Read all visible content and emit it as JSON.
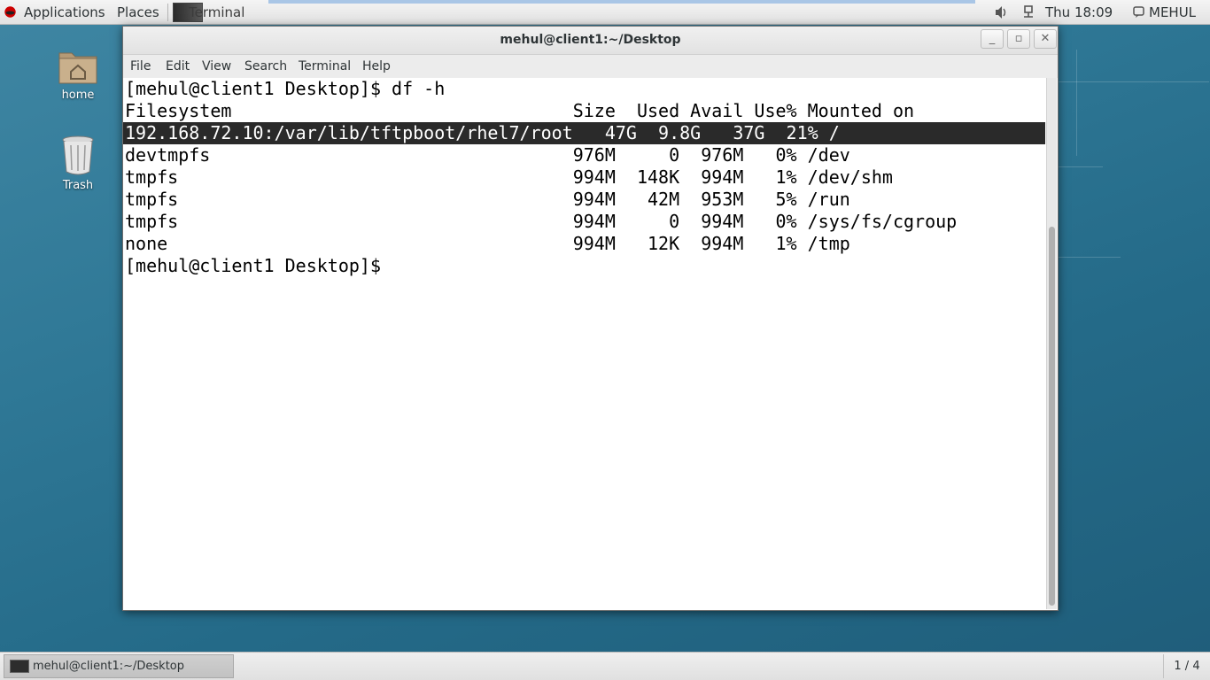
{
  "topbar": {
    "applications": "Applications",
    "places": "Places",
    "task": "Terminal",
    "clock": "Thu 18:09",
    "user": "MEHUL"
  },
  "desktop": {
    "icons": [
      {
        "label": "home",
        "icon": "home-folder-icon"
      },
      {
        "label": "Trash",
        "icon": "trash-icon"
      }
    ]
  },
  "window": {
    "title": "mehul@client1:~/Desktop",
    "menu": [
      "File",
      "Edit",
      "View",
      "Search",
      "Terminal",
      "Help"
    ]
  },
  "terminal": {
    "lines": [
      "[mehul@client1 Desktop]$ df -h",
      "Filesystem                                Size  Used Avail Use% Mounted on",
      "192.168.72.10:/var/lib/tftpboot/rhel7/root   47G  9.8G   37G  21% /",
      "devtmpfs                                  976M     0  976M   0% /dev",
      "tmpfs                                     994M  148K  994M   1% /dev/shm",
      "tmpfs                                     994M   42M  953M   5% /run",
      "tmpfs                                     994M     0  994M   0% /sys/fs/cgroup",
      "none                                      994M   12K  994M   1% /tmp",
      "[mehul@client1 Desktop]$"
    ],
    "highlighted_line": 2
  },
  "bottombar": {
    "task": "mehul@client1:~/Desktop",
    "workspace": "1 / 4"
  },
  "colors": {
    "desktop_bg": "#2f7896",
    "highlight_bg": "#2a2a2a"
  }
}
